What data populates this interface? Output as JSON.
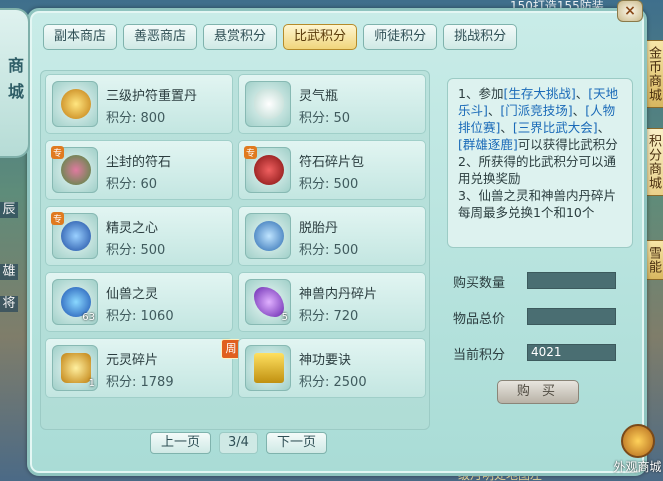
{
  "background": {
    "top_text": "150打造155防装",
    "bottom_text": "级月明处地图左",
    "left_labels": [
      "辰",
      "雄",
      "将"
    ]
  },
  "side_tabs": [
    {
      "label": "金币商城",
      "active": false
    },
    {
      "label": "积分商城",
      "active": true
    },
    {
      "label": "雪能",
      "active": false
    }
  ],
  "shop_tab": {
    "label": "商城"
  },
  "close_label": "×",
  "tabs": [
    {
      "label": "副本商店",
      "active": false
    },
    {
      "label": "善恶商店",
      "active": false
    },
    {
      "label": "悬赏积分",
      "active": false
    },
    {
      "label": "比武积分",
      "active": true
    },
    {
      "label": "师徒积分",
      "active": false
    },
    {
      "label": "挑战积分",
      "active": false
    }
  ],
  "items": [
    {
      "name": "三级护符重置丹",
      "price": "积分: 800",
      "icon": "talisman-pill-icon",
      "count": "",
      "special": "",
      "weekly": "",
      "color": "#d9a020"
    },
    {
      "name": "灵气瓶",
      "price": "积分: 50",
      "icon": "spirit-bottle-icon",
      "count": "",
      "special": "",
      "weekly": "",
      "color": "#e8f2ee"
    },
    {
      "name": "尘封的符石",
      "price": "积分: 60",
      "icon": "rune-stone-icon",
      "count": "",
      "special": "专",
      "weekly": "",
      "color": "#6a9a4a"
    },
    {
      "name": "符石碎片包",
      "price": "积分: 500",
      "icon": "rune-bag-icon",
      "count": "",
      "special": "专",
      "weekly": "",
      "color": "#b02020"
    },
    {
      "name": "精灵之心",
      "price": "积分: 500",
      "icon": "spirit-heart-icon",
      "count": "",
      "special": "专",
      "weekly": "",
      "color": "#2a6ac0"
    },
    {
      "name": "脱胎丹",
      "price": "积分: 500",
      "icon": "rebirth-pill-icon",
      "count": "",
      "special": "",
      "weekly": "",
      "color": "#3a8ad0"
    },
    {
      "name": "仙兽之灵",
      "price": "积分: 1060",
      "icon": "beast-soul-icon",
      "count": "63",
      "special": "",
      "weekly": "",
      "color": "#2a7ad8"
    },
    {
      "name": "神兽内丹碎片",
      "price": "积分: 720",
      "icon": "beast-core-shard-icon",
      "count": "5",
      "special": "",
      "weekly": "",
      "color": "#9a4ad8"
    },
    {
      "name": "元灵碎片",
      "price": "积分: 1789",
      "icon": "soul-shard-icon",
      "count": "1",
      "special": "",
      "weekly": "周",
      "color": "#e0a820"
    },
    {
      "name": "神功要诀",
      "price": "积分: 2500",
      "icon": "skill-book-icon",
      "count": "",
      "special": "",
      "weekly": "",
      "color": "#e8c020"
    }
  ],
  "pager": {
    "prev": "上一页",
    "page": "3/4",
    "next": "下一页"
  },
  "info": {
    "l1a": "1、参加",
    "l1b": "[生存大挑战]",
    "l1c": "、",
    "l1d": "[天地乐斗]",
    "l1e": "、",
    "l1f": "[门派竞技场]",
    "l1g": "、",
    "l1h": "[人物排位赛]",
    "l1i": "、",
    "l1j": "[三界比武大会]",
    "l1k": "、",
    "l1l": "[群雄逐鹿]",
    "l1m": "可以获得比武积分",
    "l2": "2、所获得的比武积分可以通用兑换奖励",
    "l3": "3、仙兽之灵和神兽内丹碎片每周最多兑换1个和10个"
  },
  "form": {
    "qty_label": "购买数量",
    "qty_value": "",
    "total_label": "物品总价",
    "total_value": "",
    "points_label": "当前积分",
    "points_value": "4021"
  },
  "buy_label": "购 买",
  "outer_shop_label": "外观商城"
}
